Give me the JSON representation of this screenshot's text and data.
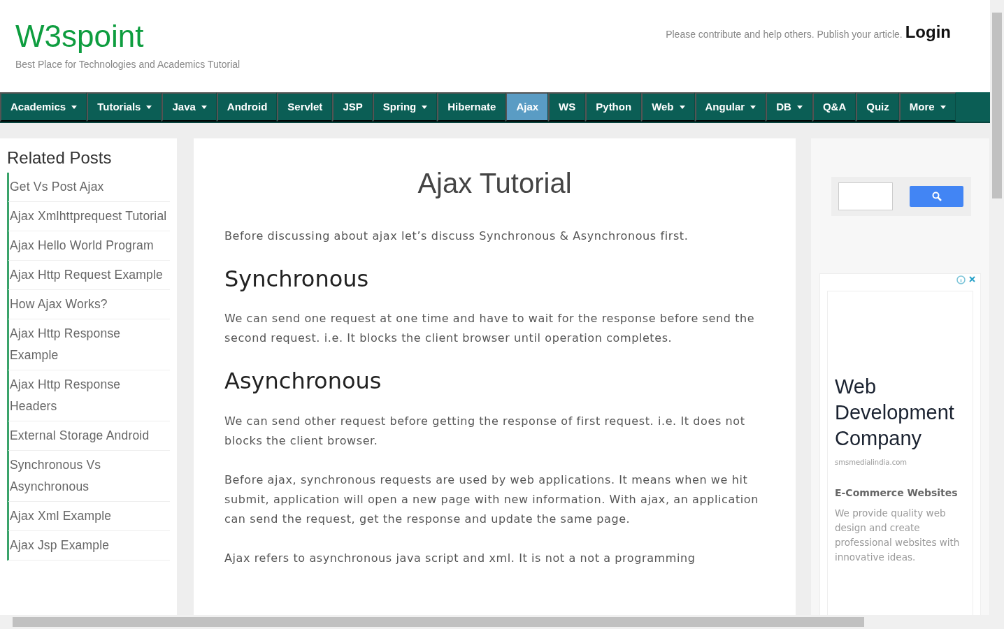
{
  "site": {
    "logo": "W3spoint",
    "tagline": "Best Place for Technologies and Academics Tutorial",
    "contribute_text": "Please contribute and help others. Publish your article.",
    "login": "Login"
  },
  "nav": [
    {
      "label": "Academics",
      "dropdown": true,
      "selected": false
    },
    {
      "label": "Tutorials",
      "dropdown": true,
      "selected": false
    },
    {
      "label": "Java",
      "dropdown": true,
      "selected": false
    },
    {
      "label": "Android",
      "dropdown": false,
      "selected": false
    },
    {
      "label": "Servlet",
      "dropdown": false,
      "selected": false
    },
    {
      "label": "JSP",
      "dropdown": false,
      "selected": false
    },
    {
      "label": "Spring",
      "dropdown": true,
      "selected": false
    },
    {
      "label": "Hibernate",
      "dropdown": false,
      "selected": false
    },
    {
      "label": "Ajax",
      "dropdown": false,
      "selected": true
    },
    {
      "label": "WS",
      "dropdown": false,
      "selected": false
    },
    {
      "label": "Python",
      "dropdown": false,
      "selected": false
    },
    {
      "label": "Web",
      "dropdown": true,
      "selected": false
    },
    {
      "label": "Angular",
      "dropdown": true,
      "selected": false
    },
    {
      "label": "DB",
      "dropdown": true,
      "selected": false
    },
    {
      "label": "Q&A",
      "dropdown": false,
      "selected": false
    },
    {
      "label": "Quiz",
      "dropdown": false,
      "selected": false
    },
    {
      "label": "More",
      "dropdown": true,
      "selected": false
    }
  ],
  "sidebar": {
    "title": "Related Posts",
    "items": [
      "Get Vs Post Ajax",
      "Ajax Xmlhttprequest Tutorial",
      "Ajax Hello World Program",
      "Ajax Http Request Example",
      "How Ajax Works?",
      "Ajax Http Response Example",
      "Ajax Http Response Headers",
      "External Storage Android",
      "Synchronous Vs Asynchronous",
      "Ajax Xml Example",
      "Ajax Jsp Example"
    ]
  },
  "article": {
    "title": "Ajax Tutorial",
    "blocks": [
      {
        "kind": "paragraph",
        "text": "Before discussing about ajax let’s discuss Synchronous & Asynchronous first."
      },
      {
        "kind": "heading",
        "text": "Synchronous"
      },
      {
        "kind": "paragraph",
        "text": "We can send one request at one time and have to wait for the response before send the second request. i.e. It blocks the client browser until operation completes."
      },
      {
        "kind": "heading",
        "text": "Asynchronous"
      },
      {
        "kind": "paragraph",
        "text": "We can send other request before getting the response of first request. i.e. It does not blocks the client browser."
      },
      {
        "kind": "paragraph",
        "text": "Before ajax, synchronous requests are used by web applications. It means when we hit submit, application will open a new page with new information. With ajax, an application can send the request, get the response and update the same page."
      },
      {
        "kind": "paragraph",
        "text": "Ajax refers to asynchronous java script and xml. It is not a not a programming"
      }
    ]
  },
  "ad": {
    "headline": "Web Development Company",
    "domain": "smsmedialindia.com",
    "subhead": "E-Commerce Websites",
    "body": "We provide quality web design and create professional websites with innovative ideas."
  }
}
